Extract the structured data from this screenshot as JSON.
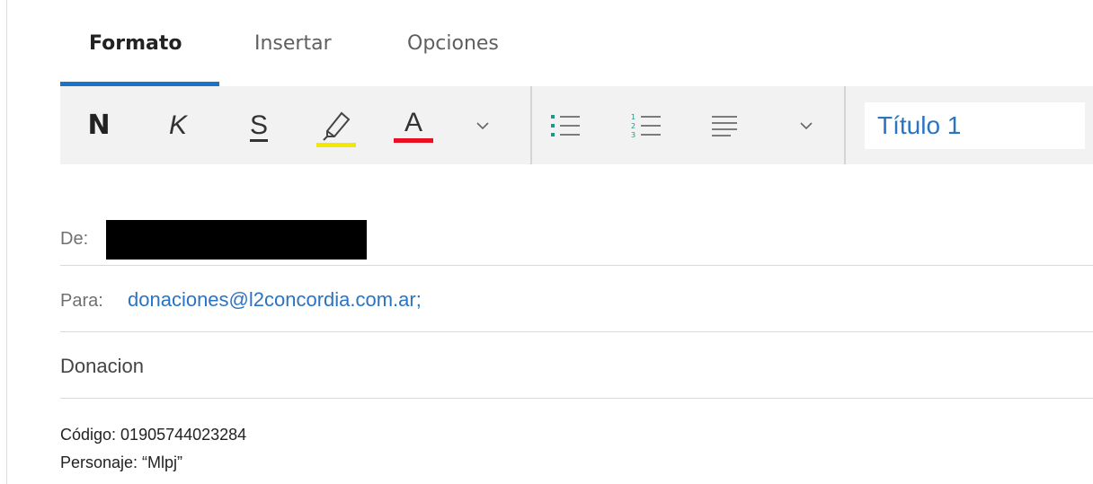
{
  "tabs": [
    {
      "label": "Formato",
      "active": true
    },
    {
      "label": "Insertar",
      "active": false
    },
    {
      "label": "Opciones",
      "active": false
    }
  ],
  "toolbar": {
    "bold_label": "N",
    "italic_label": "K",
    "underline_label": "S",
    "font_color_label": "A",
    "highlight_icon": "highlighter-icon",
    "bullet_list_icon": "bullet-list-icon",
    "numbered_list_icon": "numbered-list-icon",
    "align_icon": "align-left-icon",
    "more_icon": "chevron-down-icon",
    "style_value": "Título 1",
    "colors": {
      "highlight": "#f5e800",
      "font_color": "#e81123",
      "list_icon_accent": "#1a9a8a"
    }
  },
  "from": {
    "label": "De:"
  },
  "to": {
    "label": "Para:",
    "value": "donaciones@l2concordia.com.ar;"
  },
  "subject": {
    "value": "Donacion"
  },
  "body": {
    "line1": "Código: 01905744023284",
    "line2": "Personaje: “Mlpj”"
  },
  "colors": {
    "accent": "#1a73c9",
    "link": "#2b74c2"
  }
}
